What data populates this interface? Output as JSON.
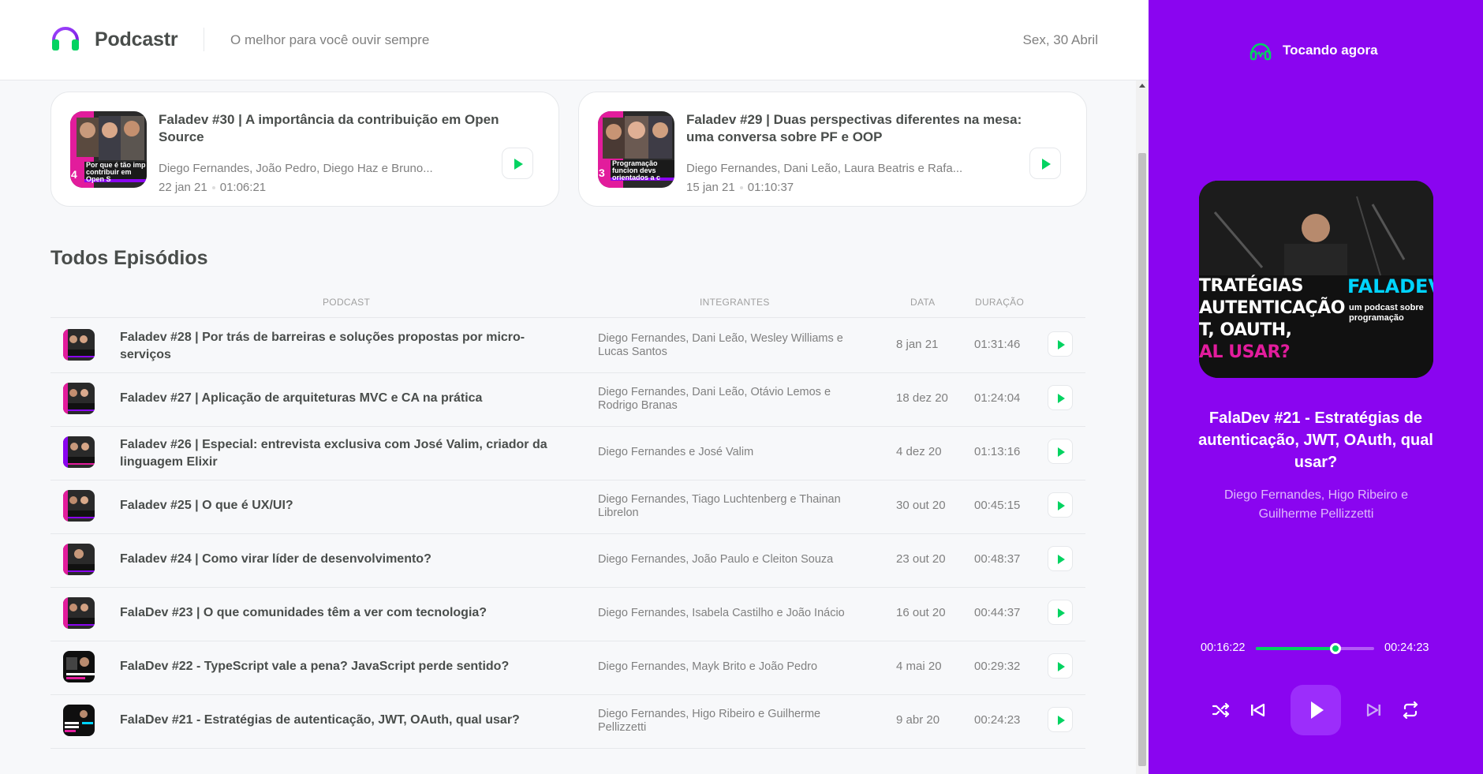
{
  "header": {
    "app_name": "Podcastr",
    "tagline": "O melhor para você ouvir sempre",
    "date": "Sex, 30 Abril"
  },
  "latest": [
    {
      "title": "Faladev #30 | A importância da contribuição em Open Source",
      "members": "Diego Fernandes, João Pedro, Diego Haz e Bruno...",
      "date": "22 jan 21",
      "duration": "01:06:21",
      "thumb_text": "Por que é tão imp contribuir em Open S",
      "thumb_number": "4"
    },
    {
      "title": "Faladev #29 | Duas perspectivas diferentes na mesa: uma conversa sobre PF e OOP",
      "members": "Diego Fernandes, Dani Leão, Laura Beatris e Rafa...",
      "date": "15 jan 21",
      "duration": "01:10:37",
      "thumb_text": "Programação funcion devs orientados a c",
      "thumb_number": "3"
    }
  ],
  "all_episodes": {
    "title": "Todos Episódios",
    "columns": [
      "Podcast",
      "Integrantes",
      "Data",
      "Duração"
    ],
    "rows": [
      {
        "title": "Faladev #28 | Por trás de barreiras e soluções propostas por micro-serviços",
        "members": "Diego Fernandes, Dani Leão, Wesley Williams e Lucas Santos",
        "date": "8 jan 21",
        "duration": "01:31:46"
      },
      {
        "title": "Faladev #27 | Aplicação de arquiteturas MVC e CA na prática",
        "members": "Diego Fernandes, Dani Leão, Otávio Lemos e Rodrigo Branas",
        "date": "18 dez 20",
        "duration": "01:24:04"
      },
      {
        "title": "Faladev #26 | Especial: entrevista exclusiva com José Valim, criador da linguagem Elixir",
        "members": "Diego Fernandes e José Valim",
        "date": "4 dez 20",
        "duration": "01:13:16"
      },
      {
        "title": "Faladev #25 | O que é UX/UI?",
        "members": "Diego Fernandes, Tiago Luchtenberg e Thainan Librelon",
        "date": "30 out 20",
        "duration": "00:45:15"
      },
      {
        "title": "Faladev #24 | Como virar líder de desenvolvimento?",
        "members": "Diego Fernandes, João Paulo e Cleiton Souza",
        "date": "23 out 20",
        "duration": "00:48:37"
      },
      {
        "title": "FalaDev #23 | O que comunidades têm a ver com tecnologia?",
        "members": "Diego Fernandes, Isabela Castilho e João Inácio",
        "date": "16 out 20",
        "duration": "00:44:37"
      },
      {
        "title": "FalaDev #22 - TypeScript vale a pena? JavaScript perde sentido?",
        "members": "Diego Fernandes, Mayk Brito e João Pedro",
        "date": "4 mai 20",
        "duration": "00:29:32"
      },
      {
        "title": "FalaDev #21 - Estratégias de autenticação, JWT, OAuth, qual usar?",
        "members": "Diego Fernandes, Higo Ribeiro e Guilherme Pellizzetti",
        "date": "9 abr 20",
        "duration": "00:24:23"
      }
    ]
  },
  "player": {
    "heading": "Tocando agora",
    "cover_lines": [
      "TRATÉGIAS",
      "AUTENTICAÇÃO",
      "T, OAUTH,",
      "AL USAR?"
    ],
    "cover_brand": "FALADEV",
    "cover_brand_sub": "um podcast sobre programação",
    "title": "FalaDev #21 - Estratégias de autenticação, JWT, OAuth, qual usar?",
    "members": "Diego Fernandes, Higo Ribeiro e Guilherme Pellizzetti",
    "current_time": "00:16:22",
    "total_time": "00:24:23",
    "progress": 0.671
  },
  "colors": {
    "accent_purple": "#8a05f0",
    "accent_green": "#04d361",
    "text_dark": "#494d4b",
    "text_muted": "#808080"
  },
  "icons": [
    "headphones-icon",
    "play-icon",
    "shuffle-icon",
    "previous-icon",
    "next-icon",
    "repeat-icon"
  ]
}
